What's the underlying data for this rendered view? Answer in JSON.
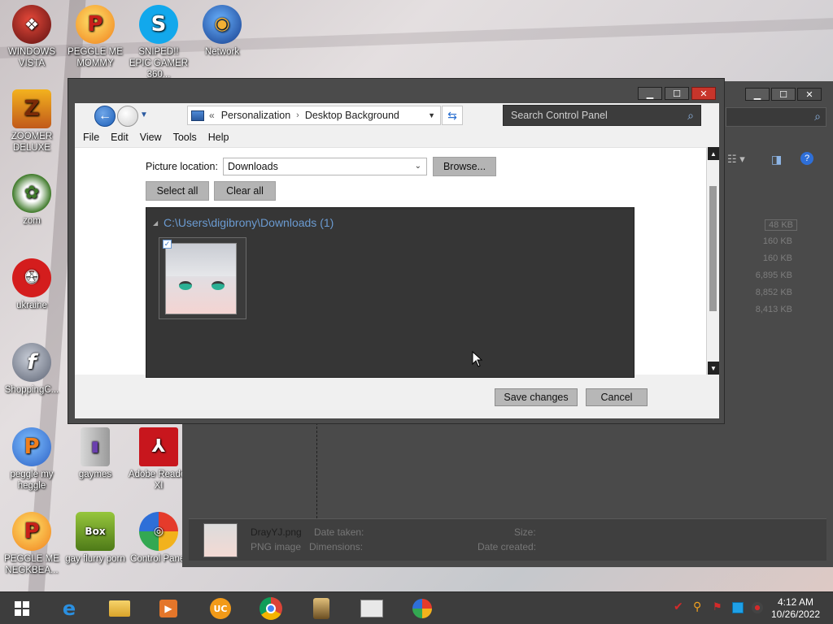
{
  "desktop": {
    "icons": [
      {
        "label": "WINDOWS VISTA",
        "icon": "vista-icon"
      },
      {
        "label": "PEGGLE ME MOMMY",
        "icon": "peggle-icon"
      },
      {
        "label": "SNIPED!! EPIC GAMER 360...",
        "icon": "skype-icon"
      },
      {
        "label": "Network",
        "icon": "network-globe-icon"
      },
      {
        "label": "ZOOMER DELUXE",
        "icon": "zuma-icon"
      },
      {
        "label": "zom",
        "icon": "plant-icon"
      },
      {
        "label": "ukraine",
        "icon": "radiation-icon"
      },
      {
        "label": "ShoppingC...",
        "icon": "flash-icon"
      },
      {
        "label": "peggle my heggle",
        "icon": "peggle-icon"
      },
      {
        "label": "gaymes",
        "icon": "folder-icon"
      },
      {
        "label": "Adobe Reader XI",
        "icon": "adobe-reader-icon"
      },
      {
        "label": "PEGGLE ME NEGKBEA...",
        "icon": "peggle-icon"
      },
      {
        "label": "gay flurry porn",
        "icon": "gamebox-icon"
      },
      {
        "label": "Control Panel",
        "icon": "control-panel-icon"
      }
    ]
  },
  "dialog": {
    "breadcrumb": [
      "Personalization",
      "Desktop Background"
    ],
    "search_placeholder": "Search Control Panel",
    "menu": [
      "File",
      "Edit",
      "View",
      "Tools",
      "Help"
    ],
    "picture_location_label": "Picture location:",
    "picture_location_value": "Downloads",
    "browse_label": "Browse...",
    "select_all_label": "Select all",
    "clear_all_label": "Clear all",
    "group_path": "C:\\Users\\digibrony\\Downloads (1)",
    "save_label": "Save changes",
    "cancel_label": "Cancel"
  },
  "background_window": {
    "sizes": [
      "48 KB",
      "160 KB",
      "160 KB",
      "6,895 KB",
      "8,852 KB",
      "8,413 KB"
    ],
    "details": {
      "filename": "DrayYJ.png",
      "type": "PNG image",
      "date_taken_label": "Date taken:",
      "dimensions_label": "Dimensions:",
      "size_label": "Size:",
      "date_created_label": "Date created:"
    }
  },
  "taskbar": {
    "time": "4:12 AM",
    "date": "10/26/2022"
  },
  "colors": {
    "dialog_frame": "#4b4b4b",
    "accent_blue": "#6b9bd1",
    "close_red": "#c8352b",
    "taskbar": "#3d3d3d"
  }
}
